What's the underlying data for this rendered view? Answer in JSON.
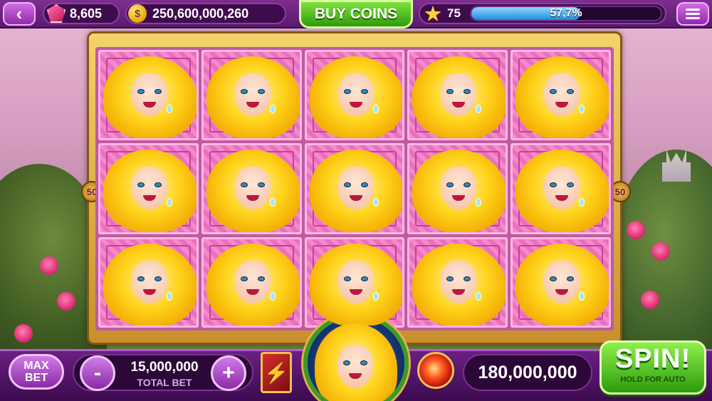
{
  "topbar": {
    "gems": "8,605",
    "coins": "250,600,000,260",
    "buy_coins_label": "BUY COINS",
    "level": "75",
    "xp_percent_text": "57,7%",
    "xp_fraction": 0.577,
    "back_icon": "chevron-left-icon",
    "menu_icon": "hamburger-menu-icon"
  },
  "reels": {
    "columns": 5,
    "rows": 3,
    "symbol": "golden-princess-symbol",
    "payline_badge": "50"
  },
  "bottombar": {
    "max_bet_label": "MAX\nBET",
    "bet_value": "15,000,000",
    "bet_label": "TOTAL BET",
    "minus_label": "-",
    "plus_label": "+",
    "win_value": "180,000,000",
    "spin_label": "SPIN!",
    "spin_sub": "HOLD FOR AUTO"
  },
  "colors": {
    "topbar": "#5a1a6d",
    "buy_coins": "#2f9a0c",
    "xp_fill": "#1f8be0",
    "spin": "#2c9c0c",
    "reel_bg": "#f48acb",
    "frame_gold": "#c8902c"
  }
}
